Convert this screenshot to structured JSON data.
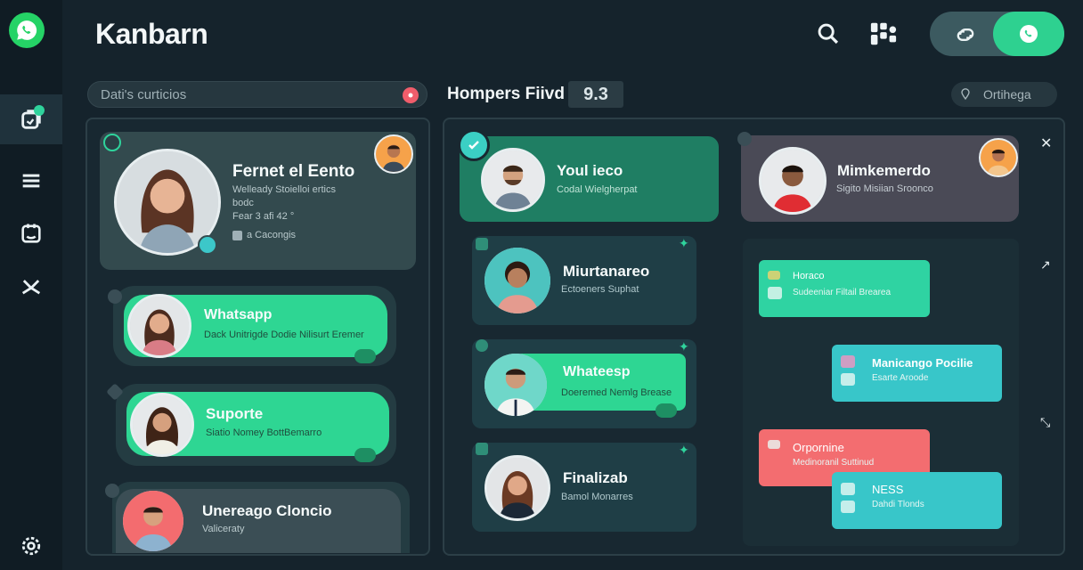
{
  "header": {
    "title": "Kanbarn"
  },
  "filters": {
    "search_text": "Dati's curticios",
    "board_title": "Hompers Fiivd",
    "board_count": "9.3",
    "right_filter": "Ortihega"
  },
  "colors": {
    "accent": "#2ed190",
    "bg": "#15232c",
    "alert": "#f05d6b"
  },
  "left_column": {
    "featured": {
      "title": "Fernet el Eento",
      "line1": "Welleady Stoielloi ertics",
      "line2": "bodc",
      "line3": "Fear 3 afi 42 °",
      "meta": "a Cacongis"
    },
    "cards": [
      {
        "title": "Whatsapp",
        "subtitle": "Dack Unitrigde Dodie Nilisurt Eremer"
      },
      {
        "title": "Suporte",
        "subtitle": "Siatio Nomey BottBemarro"
      },
      {
        "title": "Unereago Cloncio",
        "subtitle": "Valiceraty"
      }
    ]
  },
  "middle_column": {
    "cards": [
      {
        "title": "Youl ieco",
        "subtitle": "Codal Wielgherpat"
      },
      {
        "title": "Miurtanareo",
        "subtitle": "Ectoeners Suphat"
      },
      {
        "title": "Whateesp",
        "subtitle": "Doeremed Nemlg Brease"
      },
      {
        "title": "Finalizab",
        "subtitle": "Bamol Monarres"
      }
    ]
  },
  "right_column": {
    "top_card": {
      "title": "Mimkemerdo",
      "subtitle": "Sigito Misiian Sroonco"
    },
    "bubbles": [
      {
        "title": "Horaco",
        "subtitle": "Sudeeniar Filtail Brearea"
      },
      {
        "title": "Manicango Pocilie",
        "subtitle": "Esarte Aroode"
      },
      {
        "title": "Orpornine",
        "subtitle": "Medinoranil Suttinud"
      },
      {
        "title": "NESS",
        "subtitle": "Dahdi Tlonds"
      }
    ]
  }
}
